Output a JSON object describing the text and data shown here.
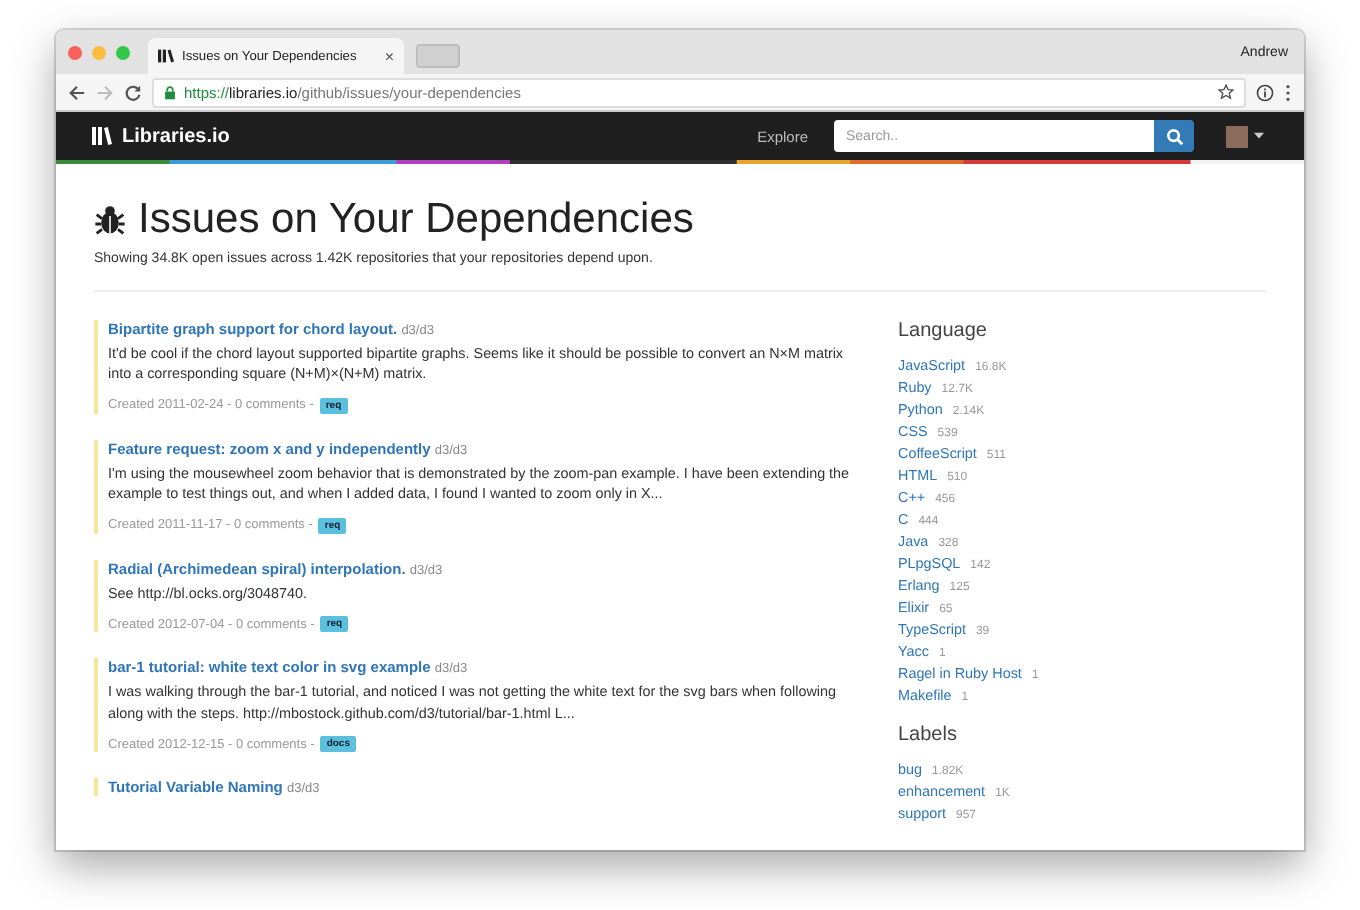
{
  "browser": {
    "tab_title": "Issues on Your Dependencies",
    "tab_close": "×",
    "user": "Andrew",
    "url_scheme": "https://",
    "url_host": "libraries.io",
    "url_path": "/github/issues/your-dependencies"
  },
  "navbar": {
    "brand": "Libraries.io",
    "link": "Explore",
    "search": {
      "placeholder": "Search.."
    }
  },
  "page": {
    "title": "Issues on Your Dependencies",
    "subtitle": "Showing 34.8K open issues across 1.42K repositories that your repositories depend upon."
  },
  "issues": [
    {
      "title": "Bipartite graph support for chord layout.",
      "repo": "d3/d3",
      "body": "It'd be cool if the chord layout supported bipartite graphs. Seems like it should be possible to convert an N×M matrix into a corresponding square (N+M)×(N+M) matrix.",
      "meta": "Created 2011-02-24 - 0 comments -",
      "label": "req"
    },
    {
      "title": "Feature request: zoom x and y independently",
      "repo": "d3/d3",
      "body": "I'm using the mousewheel zoom behavior that is demonstrated by the zoom-pan example. I have been extending the example to test things out, and when I added data, I found I wanted to zoom only in X...",
      "meta": "Created 2011-11-17 - 0 comments -",
      "label": "req"
    },
    {
      "title": "Radial (Archimedean spiral) interpolation.",
      "repo": "d3/d3",
      "body": "See http://bl.ocks.org/3048740.",
      "meta": "Created 2012-07-04 - 0 comments -",
      "label": "req"
    },
    {
      "title": "bar-1 tutorial: white text color in svg example",
      "repo": "d3/d3",
      "body": "I was walking through the bar-1 tutorial, and noticed I was not getting the white text for the svg bars when following along with the steps. http://mbostock.github.com/d3/tutorial/bar-1.html L...",
      "meta": "Created 2012-12-15 - 0 comments -",
      "label": "docs"
    },
    {
      "title": "Tutorial Variable Naming",
      "repo": "d3/d3"
    }
  ],
  "facets": [
    {
      "heading": "Language",
      "items": [
        {
          "name": "JavaScript",
          "count": "16.8K"
        },
        {
          "name": "Ruby",
          "count": "12.7K"
        },
        {
          "name": "Python",
          "count": "2.14K"
        },
        {
          "name": "CSS",
          "count": "539"
        },
        {
          "name": "CoffeeScript",
          "count": "511"
        },
        {
          "name": "HTML",
          "count": "510"
        },
        {
          "name": "C++",
          "count": "456"
        },
        {
          "name": "C",
          "count": "444"
        },
        {
          "name": "Java",
          "count": "328"
        },
        {
          "name": "PLpgSQL",
          "count": "142"
        },
        {
          "name": "Erlang",
          "count": "125"
        },
        {
          "name": "Elixir",
          "count": "65"
        },
        {
          "name": "TypeScript",
          "count": "39"
        },
        {
          "name": "Yacc",
          "count": "1"
        },
        {
          "name": "Ragel in Ruby Host",
          "count": "1"
        },
        {
          "name": "Makefile",
          "count": "1"
        }
      ]
    },
    {
      "heading": "Labels",
      "items": [
        {
          "name": "bug",
          "count": "1.82K"
        },
        {
          "name": "enhancement",
          "count": "1K"
        },
        {
          "name": "support",
          "count": "957"
        }
      ]
    }
  ]
}
